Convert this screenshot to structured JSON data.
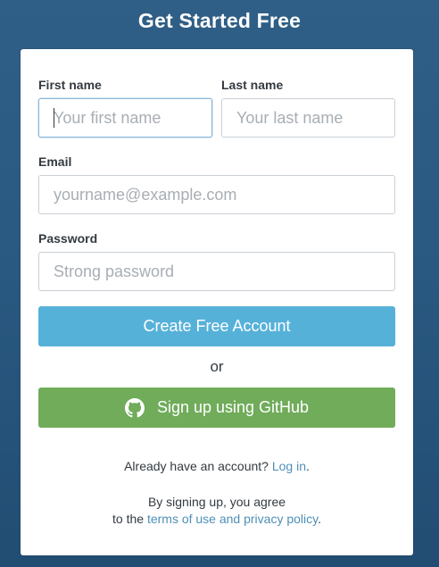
{
  "page": {
    "title": "Get Started Free"
  },
  "form": {
    "first_name": {
      "label": "First name",
      "placeholder": "Your first name",
      "value": ""
    },
    "last_name": {
      "label": "Last name",
      "placeholder": "Your last name",
      "value": ""
    },
    "email": {
      "label": "Email",
      "placeholder": "yourname@example.com",
      "value": ""
    },
    "password": {
      "label": "Password",
      "placeholder": "Strong password",
      "value": ""
    },
    "create_button_label": "Create Free Account",
    "or_text": "or",
    "github_button_label": "Sign up using GitHub",
    "github_icon": "github-icon"
  },
  "footer": {
    "already_text": "Already have an account?",
    "login_link": "Log in",
    "login_suffix": ".",
    "agree_line1": "By signing up, you agree",
    "agree_prefix": "to the",
    "terms_link": "terms of use and privacy policy",
    "agree_suffix": "."
  },
  "colors": {
    "background": "#2a5a82",
    "primary_button": "#56b1d9",
    "github_button": "#70ac5a",
    "link": "#4f8fb6"
  }
}
